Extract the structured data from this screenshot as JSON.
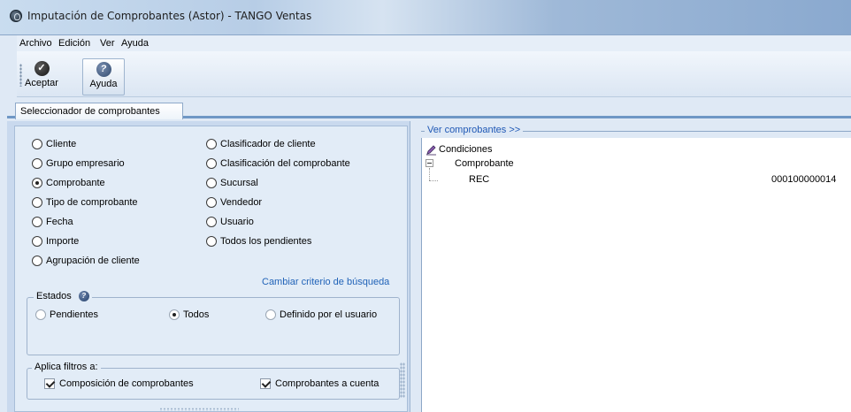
{
  "window": {
    "title": "Imputación de Comprobantes (Astor) - TANGO Ventas"
  },
  "menu": {
    "items": [
      "Archivo",
      "Edición",
      "Ver",
      "Ayuda"
    ]
  },
  "toolbar": {
    "accept_label": "Aceptar",
    "accept_icon": "check-icon",
    "help_label": "Ayuda",
    "help_icon": "help-icon"
  },
  "tabs": [
    {
      "label": "Seleccionador de comprobantes",
      "active": true
    }
  ],
  "selector": {
    "criteria_left": [
      {
        "label": "Cliente",
        "selected": false
      },
      {
        "label": "Grupo empresario",
        "selected": false
      },
      {
        "label": "Comprobante",
        "selected": true
      },
      {
        "label": "Tipo de comprobante",
        "selected": false
      },
      {
        "label": "Fecha",
        "selected": false
      },
      {
        "label": "Importe",
        "selected": false
      },
      {
        "label": "Agrupación de cliente",
        "selected": false
      }
    ],
    "criteria_right": [
      {
        "label": "Clasificador de cliente",
        "selected": false
      },
      {
        "label": "Clasificación del comprobante",
        "selected": false
      },
      {
        "label": "Sucursal",
        "selected": false
      },
      {
        "label": "Vendedor",
        "selected": false
      },
      {
        "label": "Usuario",
        "selected": false
      },
      {
        "label": "Todos los pendientes",
        "selected": false
      }
    ],
    "change_criteria_link": "Cambiar criterio de búsqueda",
    "estados": {
      "title": "Estados",
      "options": [
        {
          "label": "Pendientes",
          "selected": false
        },
        {
          "label": "Todos",
          "selected": true
        },
        {
          "label": "Definido por el usuario",
          "selected": false
        }
      ]
    },
    "filters": {
      "title": "Aplica filtros a:",
      "options": [
        {
          "label": "Composición de comprobantes",
          "checked": true
        },
        {
          "label": "Comprobantes a cuenta",
          "checked": true
        }
      ]
    }
  },
  "viewer": {
    "header": "Ver comprobantes >>",
    "tree": {
      "root": "Condiciones",
      "node": "Comprobante",
      "leaf_label": "REC",
      "leaf_value": "000100000014"
    }
  },
  "colors": {
    "link": "#2163b8",
    "tab_underline": "#6f97c5",
    "panel_bg": "#e2ecf7"
  }
}
